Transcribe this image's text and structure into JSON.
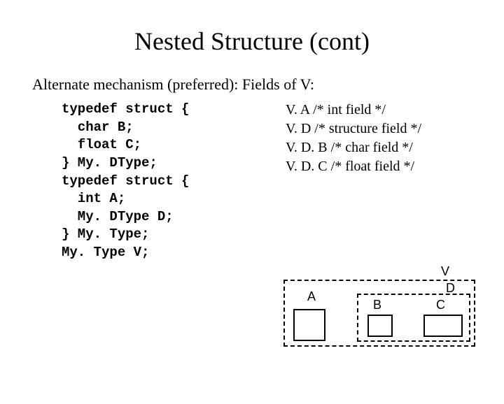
{
  "title": "Nested Structure (cont)",
  "subtitle_left": "Alternate mechanism (preferred):",
  "subtitle_right": "Fields of V:",
  "code": [
    "typedef struct {",
    "  char B;",
    "  float C;",
    "} My. DType;",
    "typedef struct {",
    "  int A;",
    "  My. DType D;",
    "} My. Type;",
    "",
    "My. Type V;"
  ],
  "fields": [
    "V. A /* int field */",
    "V. D /* structure field */",
    "V. D. B /* char field */",
    "V. D. C /* float field */"
  ],
  "diagram": {
    "V": "V",
    "A": "A",
    "D": "D",
    "B": "B",
    "C": "C"
  }
}
